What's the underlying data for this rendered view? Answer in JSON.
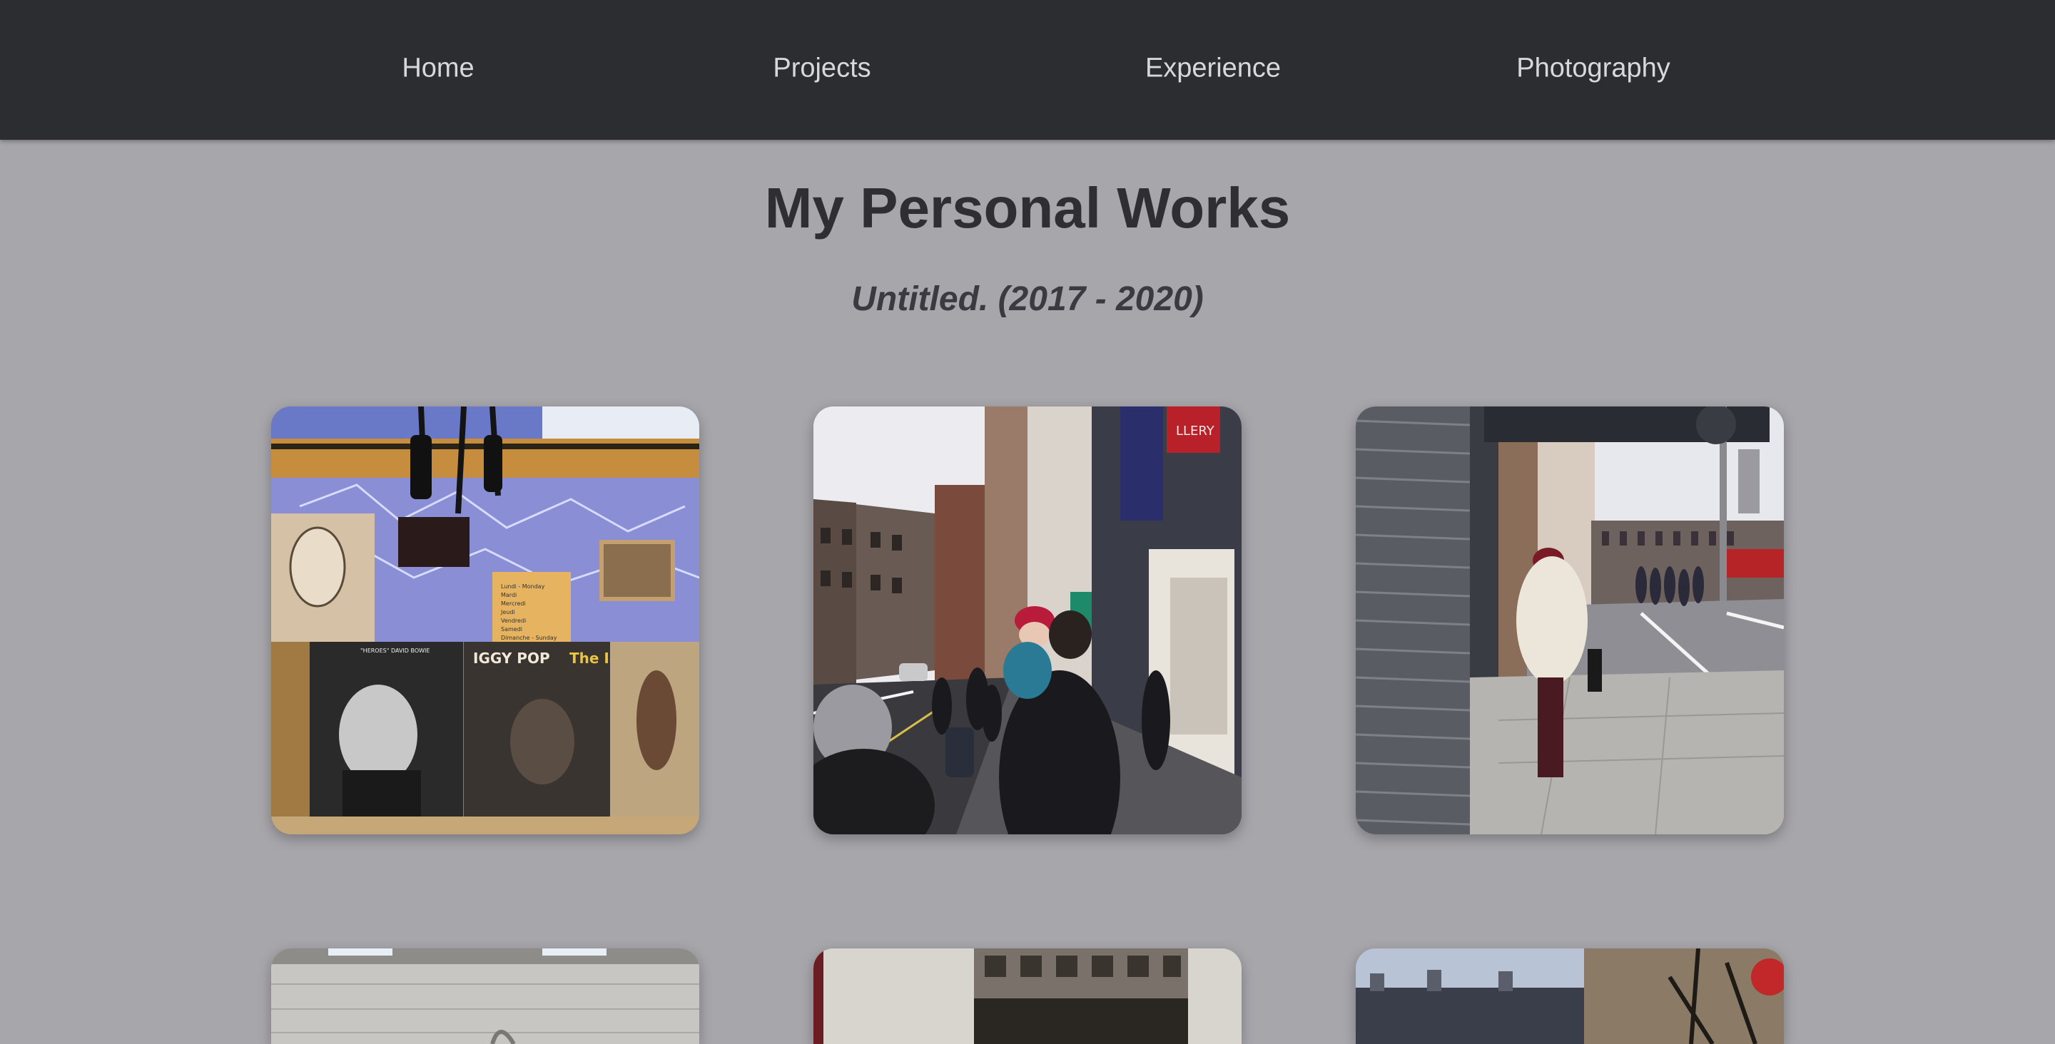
{
  "nav": {
    "items": [
      {
        "label": "Home"
      },
      {
        "label": "Projects"
      },
      {
        "label": "Experience"
      },
      {
        "label": "Photography"
      }
    ]
  },
  "main": {
    "title": "My Personal Works",
    "series_title": "Untitled. (2017 - 2020)"
  },
  "gallery": {
    "photos": [
      {
        "subject": "record-shop-window"
      },
      {
        "subject": "street-scene-crowd"
      },
      {
        "subject": "woman-in-white-coat-street-corner"
      },
      {
        "subject": "stone-building-facade"
      },
      {
        "subject": "storefront-facade"
      },
      {
        "subject": "rooftops-and-tree"
      }
    ],
    "record_labels": [
      "IGGY POP",
      "The Id",
      "\"HEROES\" DAVID BOWIE"
    ],
    "note_lines": [
      "Lundi - Monday",
      "Mardi",
      "Mercredi",
      "Jeudi",
      "Vendredi",
      "Samedi",
      "Dimanche - Sunday"
    ],
    "shop_sign": "LLERY"
  }
}
